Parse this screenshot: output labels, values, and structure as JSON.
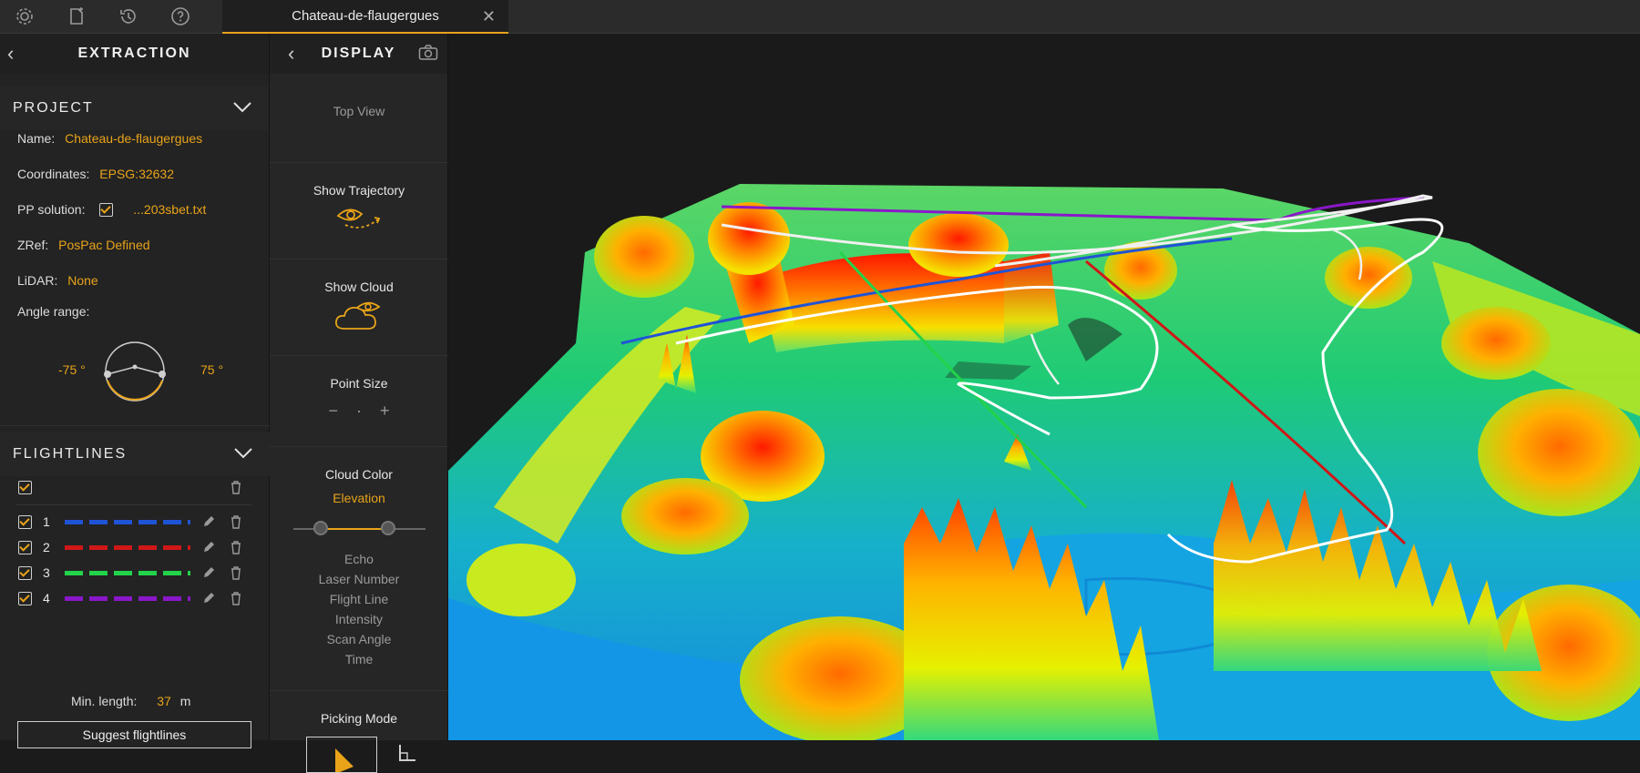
{
  "toolbar": {
    "icons": [
      "settings-icon",
      "new-file-icon",
      "history-icon",
      "help-icon"
    ]
  },
  "tab": {
    "title": "Chateau-de-flaugergues",
    "close": "✕"
  },
  "extraction": {
    "title": "EXTRACTION",
    "project": {
      "header": "PROJECT",
      "name_label": "Name:",
      "name_value": "Chateau-de-flaugergues",
      "coords_label": "Coordinates:",
      "coords_value": "EPSG:32632",
      "pp_label": "PP solution:",
      "pp_value": "...203sbet.txt",
      "zref_label": "ZRef:",
      "zref_value": "PosPac Defined",
      "lidar_label": "LiDAR:",
      "lidar_value": "None",
      "angle_label": "Angle range:",
      "angle_min": "-75 °",
      "angle_max": "75 °"
    },
    "flightlines": {
      "header": "FLIGHTLINES",
      "lines": [
        {
          "id": "1",
          "color": "#1f53d6"
        },
        {
          "id": "2",
          "color": "#d01717"
        },
        {
          "id": "3",
          "color": "#22d34b"
        },
        {
          "id": "4",
          "color": "#8a17c9"
        }
      ],
      "min_length_label": "Min. length:",
      "min_length_value": "37",
      "min_length_unit": "m",
      "suggest_button": "Suggest flightlines"
    }
  },
  "display": {
    "title": "DISPLAY",
    "top_view": "Top View",
    "show_trajectory": "Show Trajectory",
    "show_cloud": "Show Cloud",
    "point_size": "Point Size",
    "point_minus": "−",
    "point_dot": "·",
    "point_plus": "+",
    "cloud_color": "Cloud Color",
    "selected_color": "Elevation",
    "color_options": [
      "Echo",
      "Laser Number",
      "Flight Line",
      "Intensity",
      "Scan Angle",
      "Time"
    ],
    "picking_mode": "Picking Mode"
  },
  "colors": {
    "accent": "#e8a319"
  }
}
